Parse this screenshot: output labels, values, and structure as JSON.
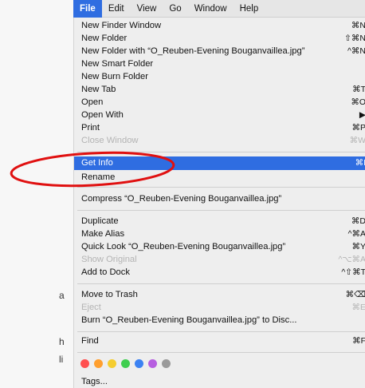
{
  "menubar": {
    "items": [
      "File",
      "Edit",
      "View",
      "Go",
      "Window",
      "Help"
    ],
    "active_index": 0
  },
  "background": {
    "left_fragments": [
      "a",
      "h",
      "li"
    ]
  },
  "menu": {
    "items": [
      {
        "label": "New Finder Window",
        "shortcut": "⌘N",
        "disabled": false
      },
      {
        "label": "New Folder",
        "shortcut": "⇧⌘N",
        "disabled": false
      },
      {
        "label": "New Folder with “O_Reuben-Evening Bouganvaillea.jpg”",
        "shortcut": "^⌘N",
        "disabled": false
      },
      {
        "label": "New Smart Folder",
        "shortcut": "",
        "disabled": false
      },
      {
        "label": "New Burn Folder",
        "shortcut": "",
        "disabled": false
      },
      {
        "label": "New Tab",
        "shortcut": "⌘T",
        "disabled": false
      },
      {
        "label": "Open",
        "shortcut": "⌘O",
        "disabled": false
      },
      {
        "label": "Open With",
        "shortcut": "▶",
        "disabled": false
      },
      {
        "label": "Print",
        "shortcut": "⌘P",
        "disabled": false
      },
      {
        "label": "Close Window",
        "shortcut": "⌘W",
        "disabled": true
      },
      {
        "label": "Get Info",
        "shortcut": "⌘I",
        "disabled": false,
        "highlighted": true
      },
      {
        "label": "Rename",
        "shortcut": "",
        "disabled": false
      },
      {
        "label": "Compress “O_Reuben-Evening Bouganvaillea.jpg”",
        "shortcut": "",
        "disabled": false
      },
      {
        "label": "Duplicate",
        "shortcut": "⌘D",
        "disabled": false
      },
      {
        "label": "Make Alias",
        "shortcut": "^⌘A",
        "disabled": false
      },
      {
        "label": "Quick Look “O_Reuben-Evening Bouganvaillea.jpg”",
        "shortcut": "⌘Y",
        "disabled": false
      },
      {
        "label": "Show Original",
        "shortcut": "^⌥⌘A",
        "disabled": true
      },
      {
        "label": "Add to Dock",
        "shortcut": "^⇧⌘T",
        "disabled": false
      },
      {
        "label": "Move to Trash",
        "shortcut": "⌘⌫",
        "disabled": false
      },
      {
        "label": "Eject",
        "shortcut": "⌘E",
        "disabled": true
      },
      {
        "label": "Burn “O_Reuben-Evening Bouganvaillea.jpg” to Disc...",
        "shortcut": "",
        "disabled": false
      },
      {
        "label": "Find",
        "shortcut": "⌘F",
        "disabled": false
      },
      {
        "label": "Tags...",
        "shortcut": "",
        "disabled": false
      }
    ],
    "tag_colors": [
      "#ff4f4f",
      "#ff9f2e",
      "#f5cd2f",
      "#3fce4f",
      "#3c82f2",
      "#b65ee0",
      "#9a9a9a"
    ]
  },
  "annotation": {
    "shape": "ellipse",
    "color": "#e01010",
    "target": "Get Info"
  }
}
